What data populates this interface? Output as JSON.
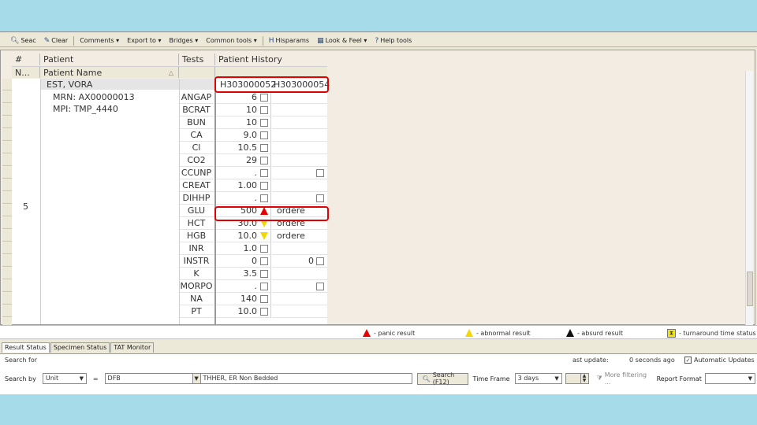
{
  "toolbar": {
    "items": [
      {
        "label": "Seac",
        "icon": "magnifier-icon"
      },
      {
        "label": "Clear",
        "icon": "clear-icon"
      },
      {
        "label": "Comments ▾"
      },
      {
        "label": "Export to ▾"
      },
      {
        "label": "Bridges ▾"
      },
      {
        "label": "Common tools ▾"
      },
      {
        "label": "Hisparams",
        "icon": "h-icon"
      },
      {
        "label": "Look & Feel ▾",
        "icon": "palette-icon"
      },
      {
        "label": "Help tools",
        "icon": "help-icon"
      }
    ]
  },
  "grid": {
    "col_num": "#",
    "col_patient": "Patient",
    "col_tests": "Tests",
    "col_history": "Patient History",
    "sub_num": "N...",
    "sub_patient_name": "Patient Name",
    "row_number": "5",
    "patient": {
      "name": "EST, VORA",
      "mrn": "MRN:  AX00000013",
      "mpi": "MPI:  TMP_4440"
    },
    "accessions": [
      "H303000052",
      "H303000054"
    ],
    "rows": [
      {
        "test": "ANGAP",
        "v1": "6",
        "flag": "box",
        "v2": "",
        "v2box": false
      },
      {
        "test": "BCRAT",
        "v1": "10",
        "flag": "box",
        "v2": "",
        "v2box": false
      },
      {
        "test": "BUN",
        "v1": "10",
        "flag": "box",
        "v2": "",
        "v2box": false
      },
      {
        "test": "CA",
        "v1": "9.0",
        "flag": "box",
        "v2": "",
        "v2box": false
      },
      {
        "test": "Cl",
        "v1": "10.5",
        "flag": "box",
        "v2": "",
        "v2box": false
      },
      {
        "test": "CO2",
        "v1": "29",
        "flag": "box",
        "v2": "",
        "v2box": false
      },
      {
        "test": "CCUNP",
        "v1": ".",
        "flag": "box",
        "v2": "",
        "v2box": true
      },
      {
        "test": "CREAT",
        "v1": "1.00",
        "flag": "box",
        "v2": "",
        "v2box": false
      },
      {
        "test": "DIHHP",
        "v1": ".",
        "flag": "box",
        "v2": "",
        "v2box": true
      },
      {
        "test": "GLU",
        "v1": "500",
        "flag": "panic",
        "v2": "ordere",
        "v2box": false
      },
      {
        "test": "HCT",
        "v1": "30.0",
        "flag": "abnormal",
        "v2": "ordere",
        "v2box": false
      },
      {
        "test": "HGB",
        "v1": "10.0",
        "flag": "abnormal",
        "v2": "ordere",
        "v2box": false
      },
      {
        "test": "INR",
        "v1": "1.0",
        "flag": "box",
        "v2": "",
        "v2box": false
      },
      {
        "test": "INSTR",
        "v1": "0",
        "flag": "box",
        "v2": "0",
        "v2box": true
      },
      {
        "test": "K",
        "v1": "3.5",
        "flag": "box",
        "v2": "",
        "v2box": false
      },
      {
        "test": "MORPO",
        "v1": ".",
        "flag": "box",
        "v2": "",
        "v2box": true
      },
      {
        "test": "NA",
        "v1": "140",
        "flag": "box",
        "v2": "",
        "v2box": false
      },
      {
        "test": "PT",
        "v1": "10.0",
        "flag": "box",
        "v2": "",
        "v2box": false
      }
    ]
  },
  "legend": {
    "panic": "- panic result",
    "abnormal": "- abnormal result",
    "absurd": "- absurd result",
    "turnaround": "- turnaround time status"
  },
  "tabs": [
    "Result Status",
    "Specimen Status",
    "TAT Monitor"
  ],
  "search": {
    "title": "Search for",
    "last_updated": "ast update:",
    "seconds_ago": "0 seconds ago",
    "auto_updates": "Automatic Updates",
    "search_by_label": "Search by",
    "search_by_value": "Unit",
    "equals": "=",
    "unit_value": "DFB",
    "unit_desc": "THHER, ER Non Bedded",
    "search_button": "Search (F12)",
    "time_frame_label": "Time Frame",
    "time_frame_value": "3 days",
    "more_filtering": "More filtering ...",
    "report_format_label": "Report Format"
  },
  "colors": {
    "panic": "#e60000",
    "abnormal": "#f2d800",
    "absurd": "#111111",
    "highlight": "#e00000"
  }
}
